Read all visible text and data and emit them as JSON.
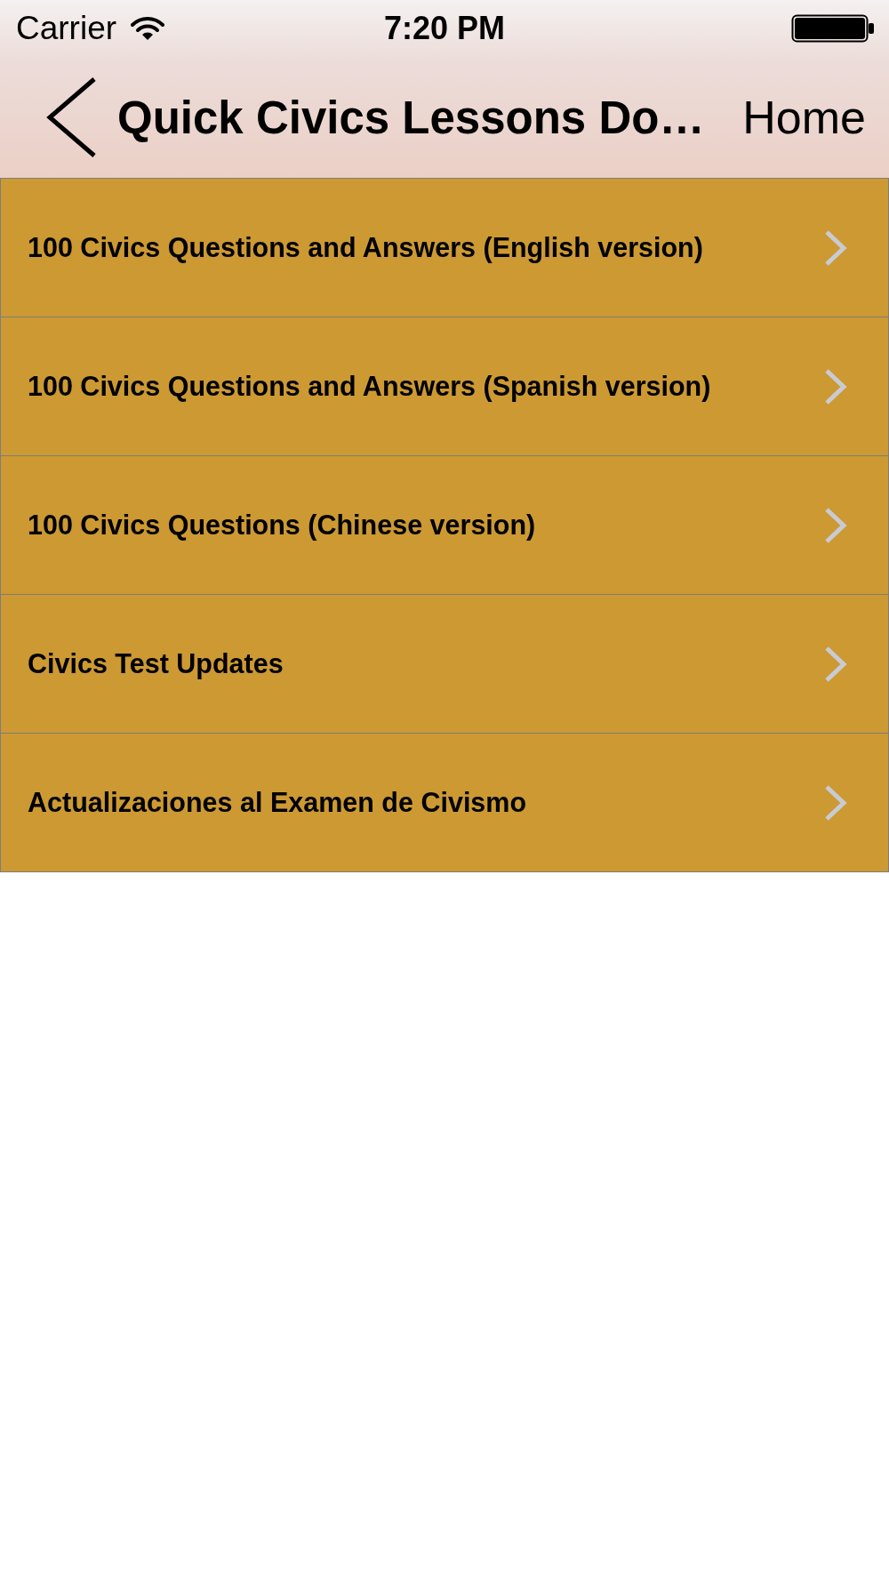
{
  "status_bar": {
    "carrier": "Carrier",
    "time": "7:20 PM"
  },
  "nav_bar": {
    "title": "Quick Civics Lessons Do…",
    "right_button": "Home"
  },
  "items": [
    {
      "label": "100 Civics Questions and Answers (English version)"
    },
    {
      "label": "100 Civics Questions and Answers (Spanish version)"
    },
    {
      "label": "100 Civics Questions (Chinese version)"
    },
    {
      "label": "Civics Test Updates"
    },
    {
      "label": "Actualizaciones al Examen de Civismo"
    }
  ]
}
